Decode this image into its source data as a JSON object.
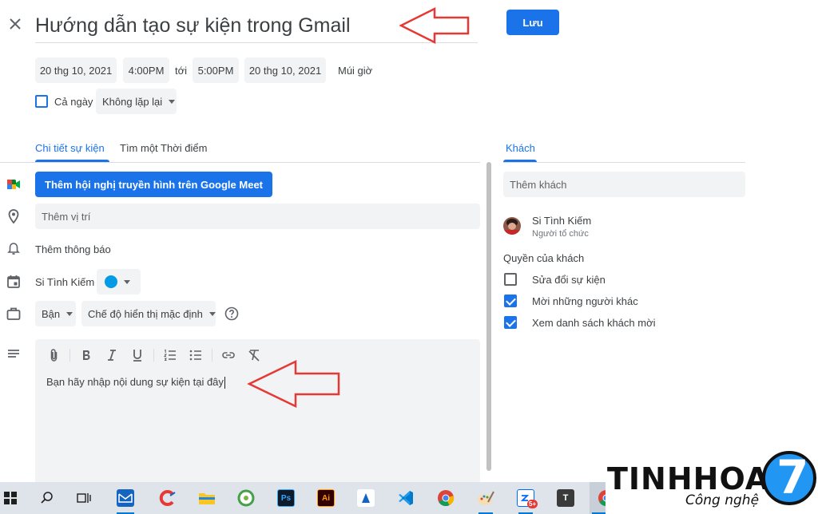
{
  "header": {
    "title": "Hướng dẫn tạo sự kiện trong Gmail",
    "save_label": "Lưu"
  },
  "datetime": {
    "start_date": "20 thg 10, 2021",
    "start_time": "4:00PM",
    "separator": "tới",
    "end_time": "5:00PM",
    "end_date": "20 thg 10, 2021",
    "timezone_label": "Múi giờ",
    "all_day_label": "Cả ngày",
    "all_day_checked": false,
    "repeat_value": "Không lặp lại"
  },
  "tabs": [
    {
      "label": "Chi tiết sự kiện",
      "active": true
    },
    {
      "label": "Tìm một Thời điểm",
      "active": false
    }
  ],
  "details": {
    "meet_button_label": "Thêm hội nghị truyền hình trên Google Meet",
    "location_placeholder": "Thêm vị trí",
    "notification_label": "Thêm thông báo",
    "calendar_owner": "Si Tình Kiếm",
    "calendar_color": "#039be5",
    "busy_value": "Bận",
    "visibility_value": "Chế độ hiển thị mặc định",
    "description_text": "Bạn hãy nhập nội dung sự kiện tại đây"
  },
  "guests": {
    "tab_label": "Khách",
    "add_placeholder": "Thêm khách",
    "organizer_name": "Si Tình Kiếm",
    "organizer_role": "Người tổ chức",
    "permissions_title": "Quyền của khách",
    "permissions": [
      {
        "label": "Sửa đổi sự kiện",
        "checked": false
      },
      {
        "label": "Mời những người khác",
        "checked": true
      },
      {
        "label": "Xem danh sách khách mời",
        "checked": true
      }
    ]
  },
  "taskbar": {
    "apps": [
      "windows-start",
      "search",
      "task-view",
      "mail",
      "ccleaner",
      "file-explorer",
      "coc-coc",
      "photoshop",
      "illustrator",
      "app",
      "vscode",
      "chrome",
      "paint",
      "zalo",
      "typora",
      "chrome-active"
    ],
    "zalo_badge": "5+",
    "photoshop_label": "Ps",
    "illustrator_label": "Ai",
    "typora_label": "T"
  },
  "watermark": {
    "brand": "TINHHOA",
    "tagline": "Công nghệ",
    "logo_digit": "7"
  },
  "colors": {
    "accent": "#1a73e8",
    "annotation_arrow": "#e53935"
  }
}
